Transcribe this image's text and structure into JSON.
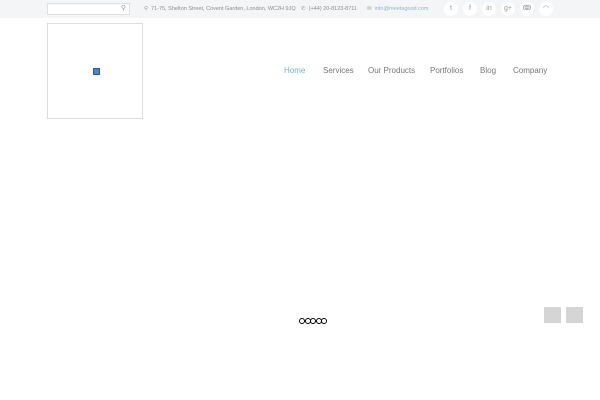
{
  "topbar": {
    "search": {
      "placeholder": "",
      "icon": "search-icon"
    },
    "address": "71-75, Shelton Street, Covent Garden, London, WC2H 9JQ",
    "phone": "(+44) 20-8123-8711",
    "email": "info@meetagood.com",
    "social": [
      {
        "name": "twitter",
        "glyph": "t"
      },
      {
        "name": "facebook",
        "glyph": "f"
      },
      {
        "name": "linkedin",
        "glyph": "in"
      },
      {
        "name": "google-plus",
        "glyph": "g+"
      },
      {
        "name": "stumbleupon",
        "glyph": "ↂ"
      },
      {
        "name": "rss",
        "glyph": "◠"
      }
    ]
  },
  "nav": [
    {
      "label": "Home",
      "active": true
    },
    {
      "label": "Services"
    },
    {
      "label": "Our Products"
    },
    {
      "label": "Portfolios"
    },
    {
      "label": "Blog"
    },
    {
      "label": "Company"
    }
  ],
  "slider": {
    "dots": 5,
    "active_dot": 1
  },
  "colors": {
    "accent": "#6fb3c9",
    "topbar": "#f3f5f7"
  }
}
